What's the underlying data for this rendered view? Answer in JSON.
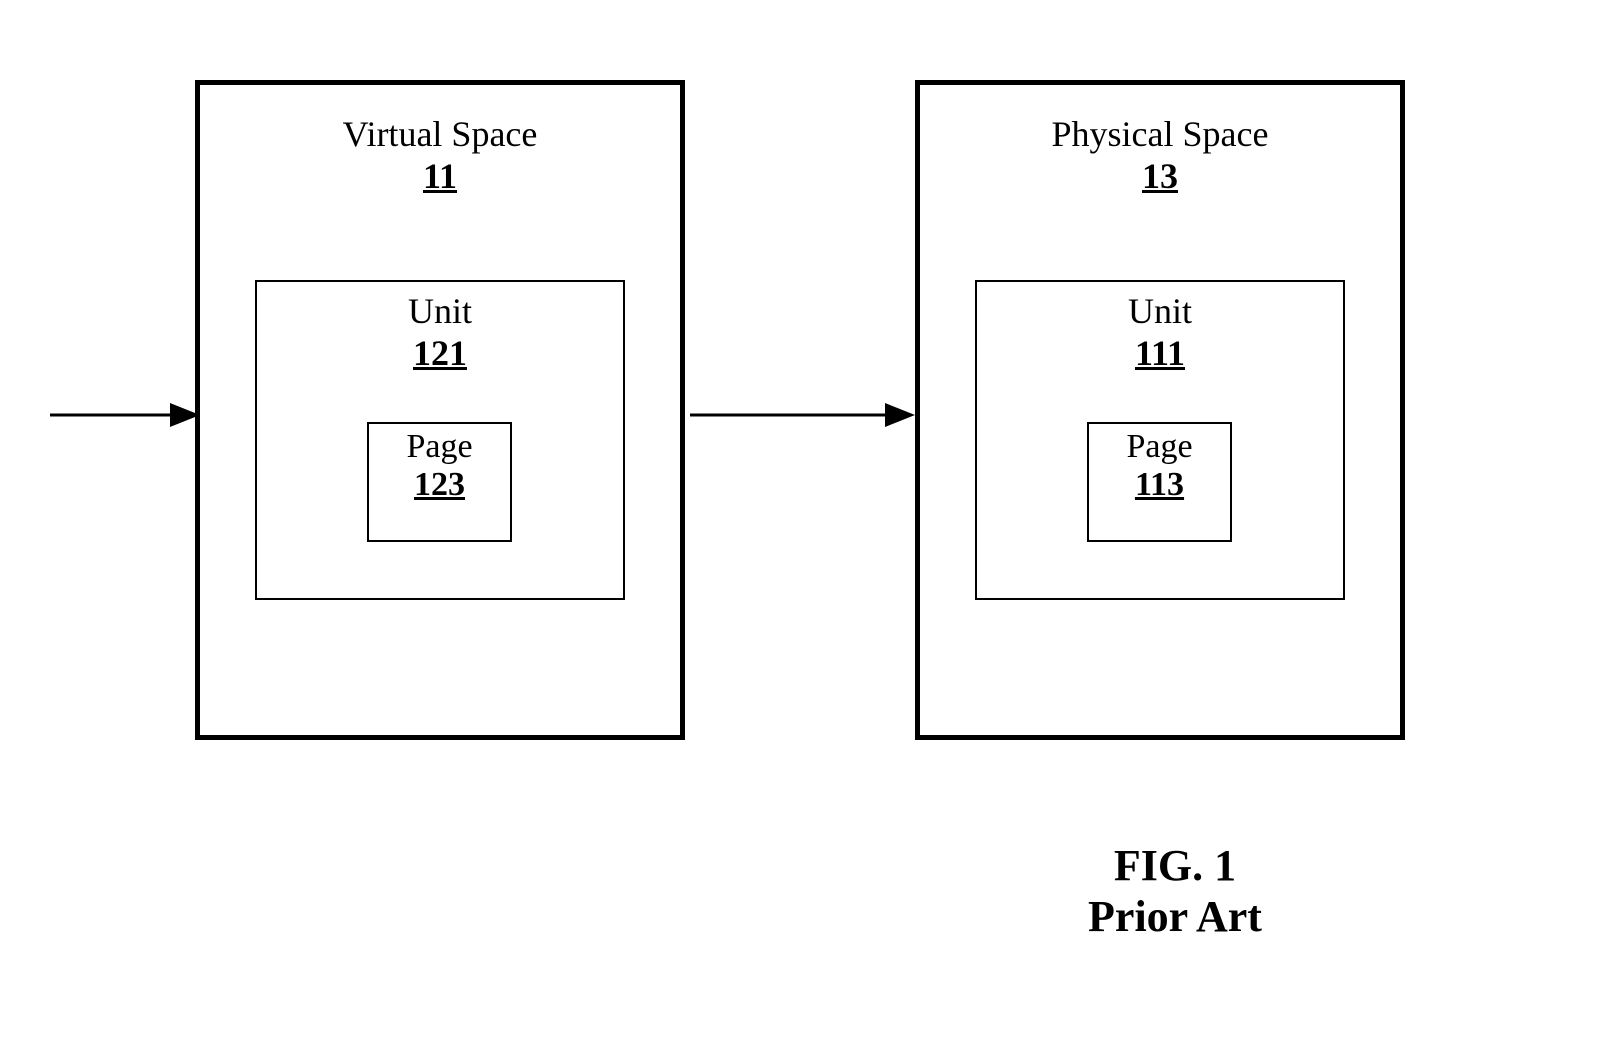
{
  "virtual": {
    "title": "Virtual Space",
    "ref": "11",
    "unit": {
      "title": "Unit",
      "ref": "121",
      "page": {
        "title": "Page",
        "ref": "123"
      }
    }
  },
  "physical": {
    "title": "Physical Space",
    "ref": "13",
    "unit": {
      "title": "Unit",
      "ref": "111",
      "page": {
        "title": "Page",
        "ref": "113"
      }
    }
  },
  "caption": {
    "line1": "FIG. 1",
    "line2": "Prior Art"
  }
}
